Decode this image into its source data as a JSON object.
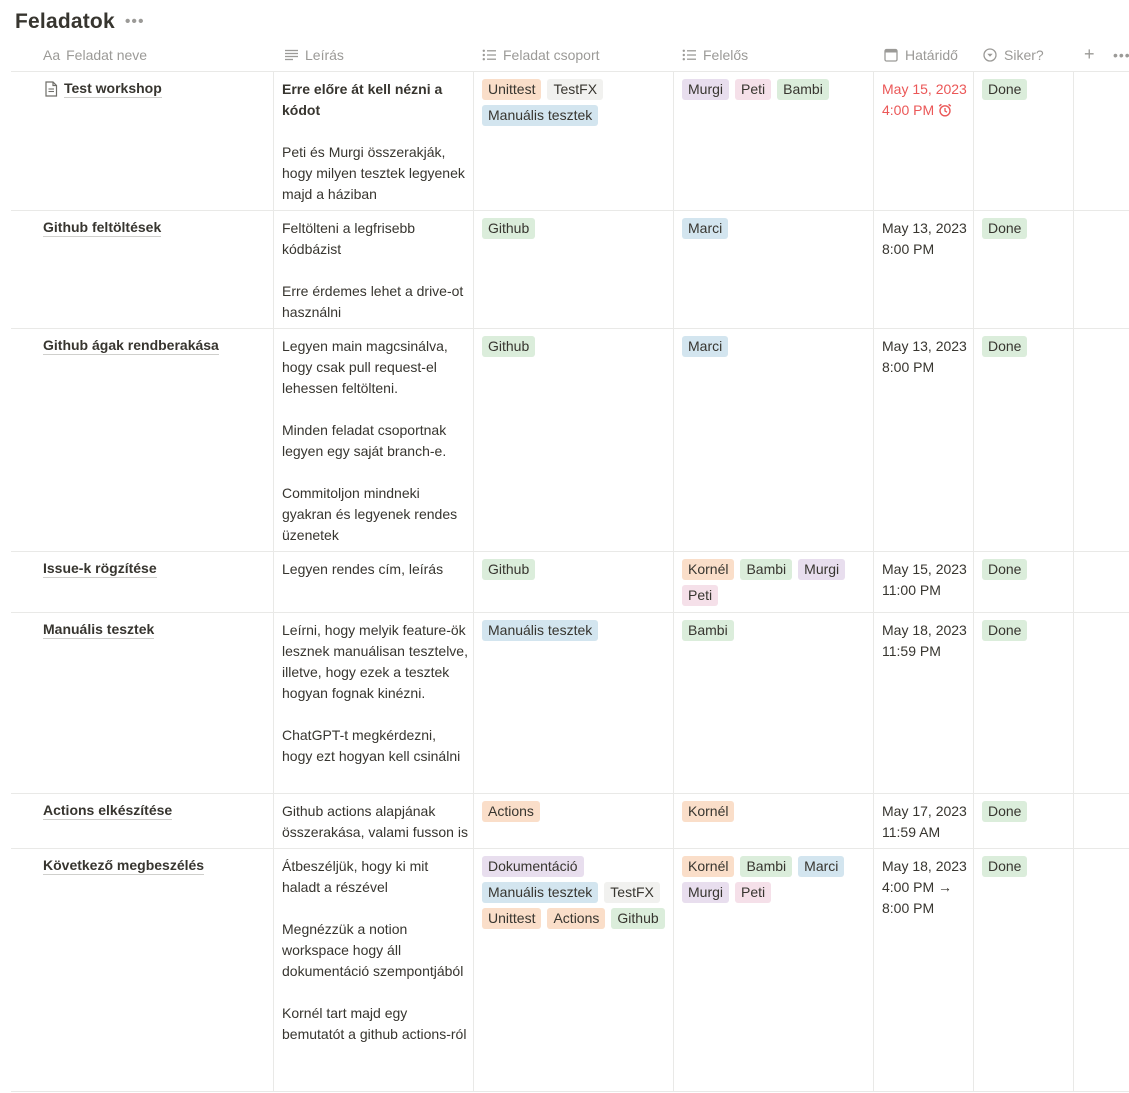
{
  "page": {
    "title": "Feladatok"
  },
  "headers": {
    "name": "Feladat neve",
    "name_icon_text": "Aa",
    "description": "Leírás",
    "group": "Feladat csoport",
    "owner": "Felelős",
    "due": "Határidő",
    "success": "Siker?"
  },
  "colors": {
    "tags": {
      "Unittest": "#fadec9",
      "TestFX": "#f1f1ef",
      "Manuális tesztek": "#d3e5ef",
      "Github": "#dbeddb",
      "Actions": "#fadec9",
      "Dokumentáció": "#e8deee",
      "Murgi": "#e8deee",
      "Peti": "#f5e0e9",
      "Bambi": "#dbeddb",
      "Marci": "#d3e5ef",
      "Kornél": "#fadec9",
      "Done": "#dbeddb"
    },
    "overdue": "#eb5757"
  },
  "rows": [
    {
      "name": "Test workshop",
      "has_doc_icon": true,
      "desc_bold": "Erre előre át kell nézni a kódot",
      "desc": [
        "Peti és Murgi összerakják, hogy milyen tesztek legyenek majd a háziban"
      ],
      "groups": [
        "Unittest",
        "TestFX",
        "Manuális tesztek"
      ],
      "owners": [
        "Murgi",
        "Peti",
        "Bambi"
      ],
      "due": "May 15, 2023 4:00 PM",
      "overdue": true,
      "success": "Done"
    },
    {
      "name": "Github feltöltések",
      "desc": [
        "Feltölteni a legfrisebb kódbázist",
        "Erre érdemes lehet a drive-ot használni"
      ],
      "groups": [
        "Github"
      ],
      "owners": [
        "Marci"
      ],
      "due": "May 13, 2023 8:00 PM",
      "success": "Done"
    },
    {
      "name": "Github ágak rendberakása",
      "desc": [
        "Legyen main magcsinálva, hogy csak pull request-el lehessen feltölteni.",
        "Minden feladat csoportnak legyen egy saját branch-e.",
        "Commitoljon mindneki gyakran és legyenek rendes üzenetek"
      ],
      "groups": [
        "Github"
      ],
      "owners": [
        "Marci"
      ],
      "due": "May 13, 2023 8:00 PM",
      "success": "Done"
    },
    {
      "name": "Issue-k rögzítése",
      "desc": [
        "Legyen rendes cím, leírás"
      ],
      "groups": [
        "Github"
      ],
      "owners": [
        "Kornél",
        "Bambi",
        "Murgi",
        "Peti"
      ],
      "due": "May 15, 2023 11:00 PM",
      "success": "Done"
    },
    {
      "name": "Manuális tesztek",
      "desc": [
        "Leírni, hogy melyik feature-ök lesznek manuálisan tesztelve, illetve, hogy ezek a tesztek hogyan fognak kinézni.",
        "ChatGPT-t megkérdezni, hogy ezt hogyan kell csinálni"
      ],
      "groups": [
        "Manuális tesztek"
      ],
      "owners": [
        "Bambi"
      ],
      "due": "May 18, 2023 11:59 PM",
      "success": "Done"
    },
    {
      "name": "Actions elkészítése",
      "desc": [
        "Github actions alapjának összerakása, valami fusson is"
      ],
      "groups": [
        "Actions"
      ],
      "owners": [
        "Kornél"
      ],
      "due": "May 17, 2023 11:59 AM",
      "success": "Done"
    },
    {
      "name": "Következő megbeszélés",
      "desc": [
        "Átbeszéljük, hogy ki mit haladt a részével",
        "Megnézzük a notion workspace hogy áll dokumentáció szempontjából",
        "Kornél tart majd egy bemutatót a github actions-ról"
      ],
      "groups": [
        "Dokumentáció",
        "Manuális tesztek",
        "TestFX",
        "Unittest",
        "Actions",
        "Github"
      ],
      "owners": [
        "Kornél",
        "Bambi",
        "Marci",
        "Murgi",
        "Peti"
      ],
      "due": "May 18, 2023 4:00 PM → 8:00 PM",
      "success": "Done"
    }
  ]
}
